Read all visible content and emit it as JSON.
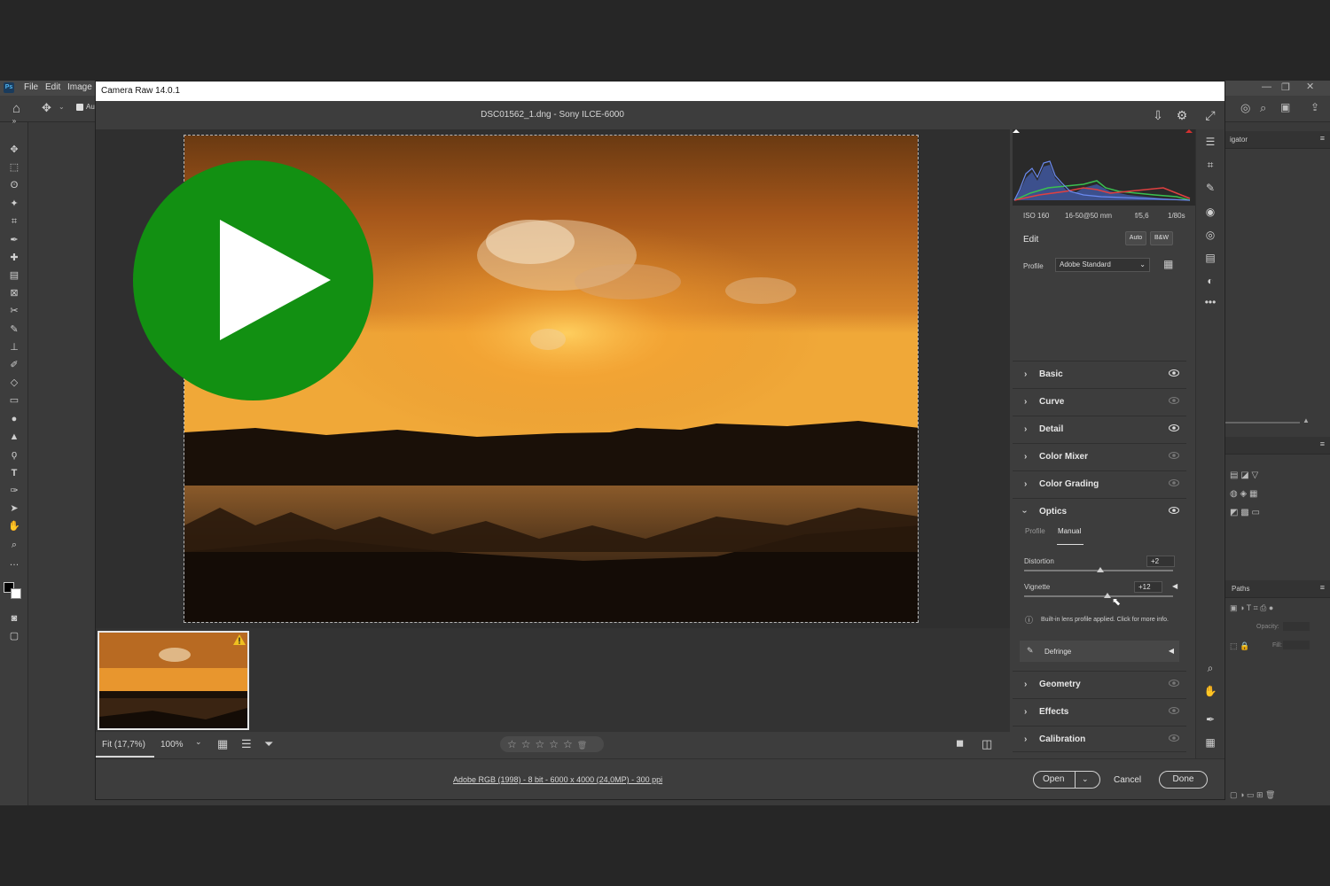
{
  "ps": {
    "logo": "Ps",
    "menu": [
      "File",
      "Edit",
      "Image"
    ],
    "option_checkbox_label": "Au",
    "panel_navigator": "igator",
    "panel_paths": "Paths",
    "opacity_label": "Opacity:",
    "fill_label": "Fill:"
  },
  "acr": {
    "window_title": "Camera Raw 14.0.1",
    "file_title": "DSC01562_1.dng  -  Sony ILCE-6000",
    "camera_info": {
      "iso": "ISO 160",
      "lens": "16-50@50 mm",
      "aperture": "f/5,6",
      "shutter": "1/80s"
    },
    "edit": {
      "title": "Edit",
      "auto_label": "Auto",
      "bw_label": "B&W",
      "profile_label": "Profile",
      "profile_value": "Adobe Standard",
      "sections": {
        "basic": "Basic",
        "curve": "Curve",
        "detail": "Detail",
        "color_mixer": "Color Mixer",
        "color_grading": "Color Grading",
        "optics": "Optics",
        "geometry": "Geometry",
        "effects": "Effects",
        "calibration": "Calibration"
      },
      "optics": {
        "tab_profile": "Profile",
        "tab_manual": "Manual",
        "distortion_label": "Distortion",
        "distortion_value": "+2",
        "distortion_level": 0.51,
        "vignette_label": "Vignette",
        "vignette_value": "+12",
        "vignette_level": 0.56,
        "lens_info": "Built-in lens profile applied.  Click for more info.",
        "defringe_label": "Defringe"
      }
    },
    "bottom": {
      "fit_label": "Fit (17,7%)",
      "zoom_label": "100%",
      "stars": "☆☆☆☆☆",
      "workflow": "Adobe RGB (1998) - 8 bit - 6000 x 4000 (24,0MP) - 300 ppi",
      "open_label": "Open",
      "cancel_label": "Cancel",
      "done_label": "Done"
    }
  },
  "colors": {
    "play_overlay": "#129012",
    "accent_red": "#d33030",
    "sky_orange": "#e0902a"
  }
}
